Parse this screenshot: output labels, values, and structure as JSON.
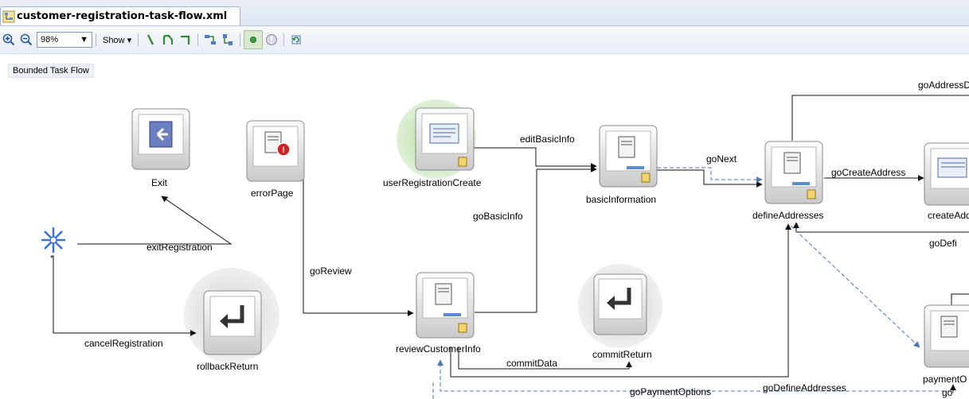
{
  "editor": {
    "tab_title": "customer-registration-task-flow.xml"
  },
  "toolbar": {
    "zoom_value": "98%",
    "show_label": "Show"
  },
  "canvas": {
    "badge": "Bounded Task Flow",
    "nodes": {
      "exit": "Exit",
      "error_page": "errorPage",
      "user_registration_create": "userRegistrationCreate",
      "basic_information": "basicInformation",
      "define_addresses": "defineAddresses",
      "create_address": "createAdd",
      "review_customer_info": "reviewCustomerInfo",
      "commit_return": "commitReturn",
      "rollback_return": "rollbackReturn",
      "payment_options": "paymentO",
      "wildcard": "*"
    },
    "edges": {
      "exit_registration": "exitRegistration",
      "cancel_registration": "cancelRegistration",
      "go_review": "goReview",
      "edit_basic_info": "editBasicInfo",
      "go_basic_info": "goBasicInfo",
      "go_next": "goNext",
      "go_create_address": "goCreateAddress",
      "go_address_d": "goAddressD",
      "go_defi": "goDefi",
      "commit_data": "commitData",
      "go_payment_options": "goPaymentOptions",
      "go_define_addresses": "goDefineAddresses",
      "go_partial": "go"
    }
  }
}
